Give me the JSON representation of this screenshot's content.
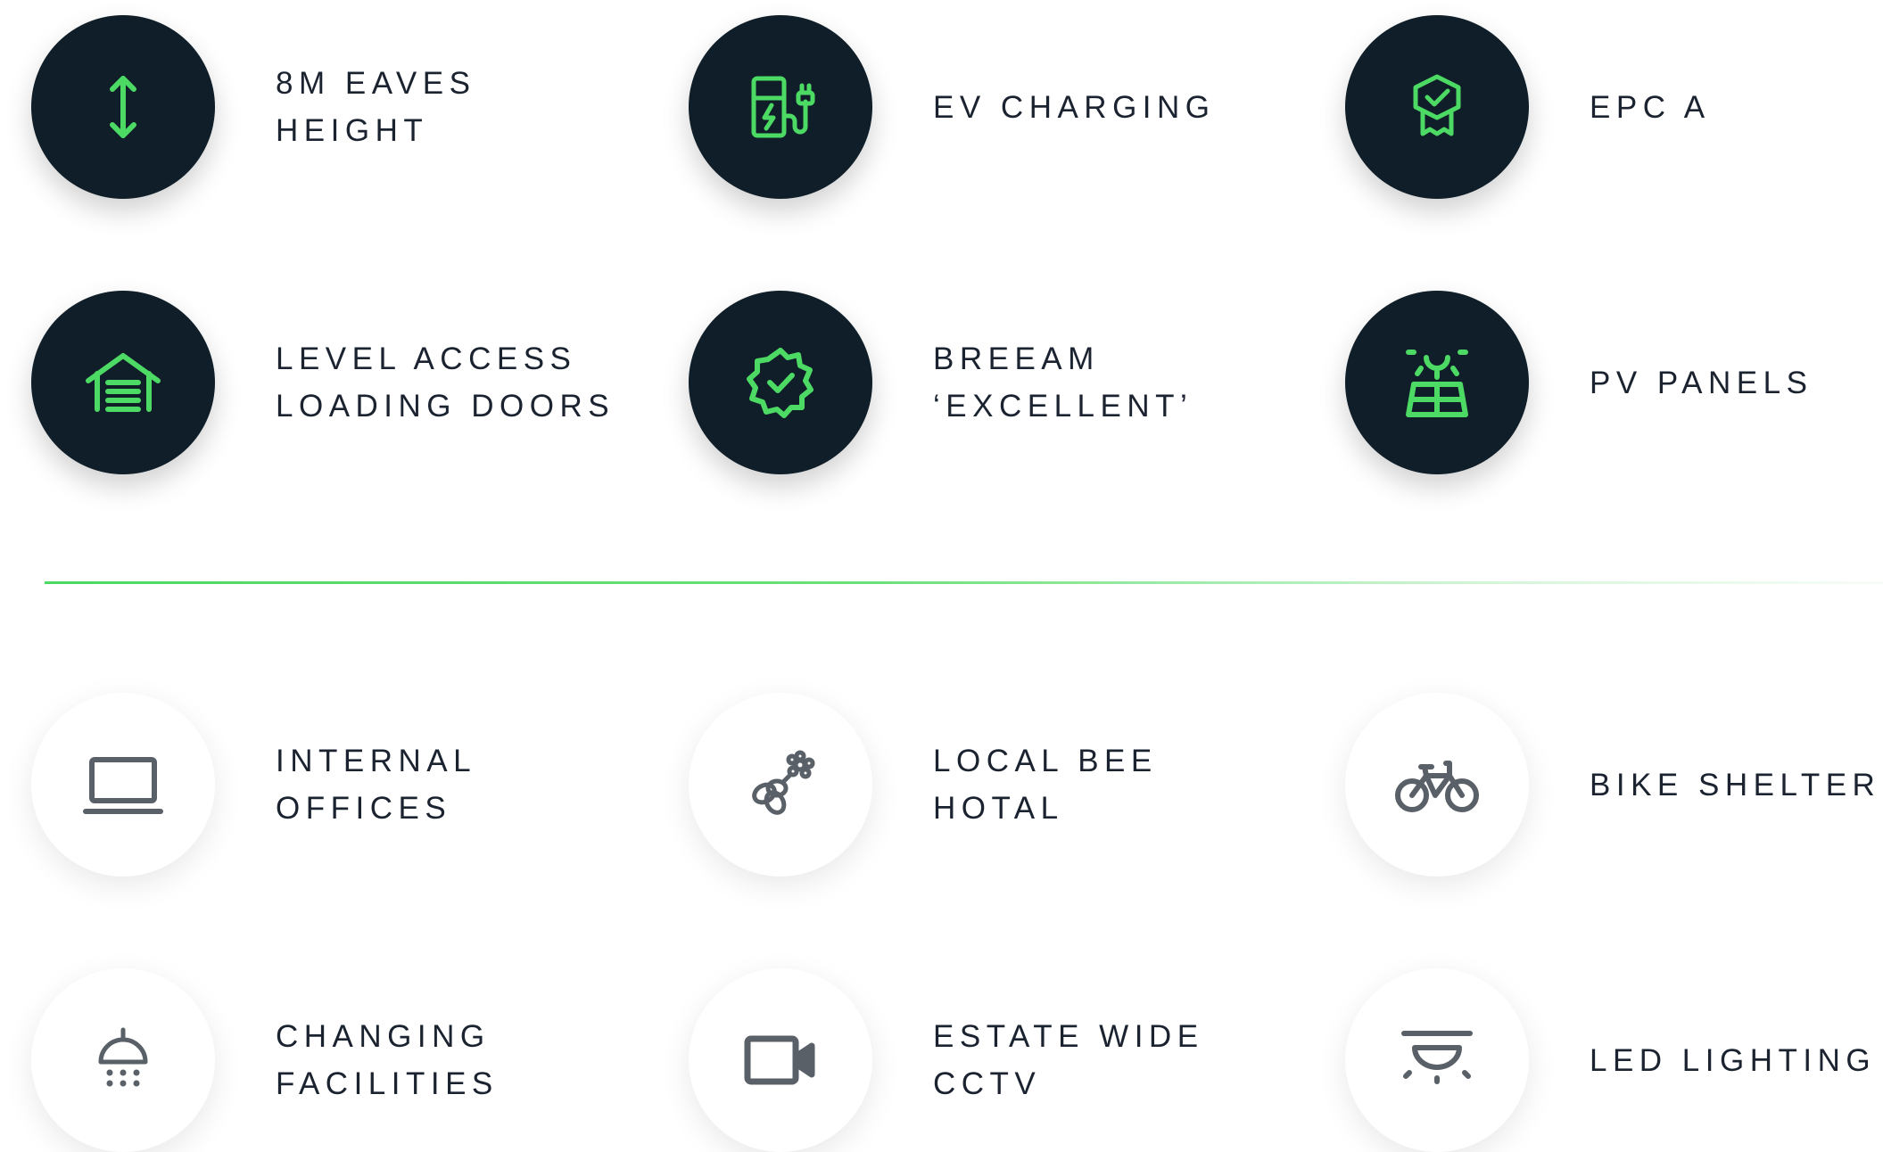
{
  "colors": {
    "primary_circle": "#0f1e28",
    "accent_green": "#4cd964",
    "secondary_icon": "#5a6068",
    "label_text": "#1b2330"
  },
  "primary_features": [
    {
      "icon": "vertical-arrows-icon",
      "line1": "8M EAVES",
      "line2": "HEIGHT"
    },
    {
      "icon": "ev-charger-icon",
      "line1": "EV CHARGING",
      "line2": ""
    },
    {
      "icon": "award-badge-icon",
      "line1": "EPC A",
      "line2": ""
    },
    {
      "icon": "garage-door-icon",
      "line1": "LEVEL ACCESS",
      "line2": "LOADING DOORS"
    },
    {
      "icon": "verified-badge-icon",
      "line1": "BREEAM",
      "line2": "‘EXCELLENT’"
    },
    {
      "icon": "solar-panel-icon",
      "line1": "PV PANELS",
      "line2": ""
    }
  ],
  "secondary_features": [
    {
      "icon": "laptop-icon",
      "line1": "INTERNAL",
      "line2": "OFFICES"
    },
    {
      "icon": "bee-flower-icon",
      "line1": "LOCAL BEE",
      "line2": "HOTAL"
    },
    {
      "icon": "bicycle-icon",
      "line1": "BIKE SHELTER",
      "line2": ""
    },
    {
      "icon": "shower-icon",
      "line1": "CHANGING",
      "line2": "FACILITIES"
    },
    {
      "icon": "video-camera-icon",
      "line1": "ESTATE WIDE",
      "line2": "CCTV"
    },
    {
      "icon": "ceiling-light-icon",
      "line1": "LED LIGHTING",
      "line2": ""
    }
  ]
}
